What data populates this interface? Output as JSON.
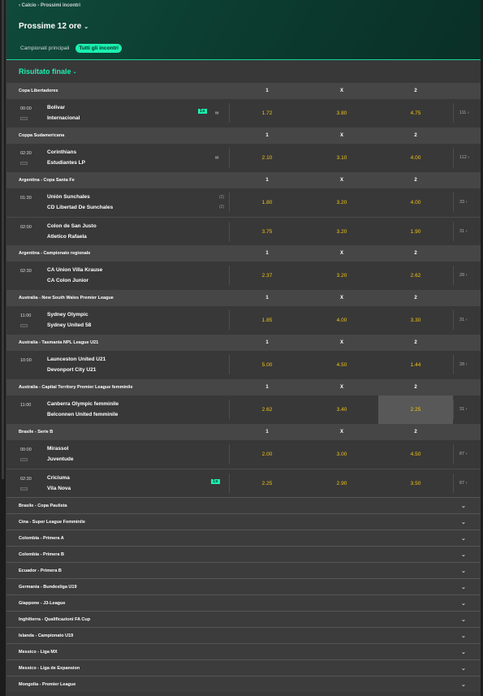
{
  "header": {
    "breadcrumb": "‹ Calcio - Prossimi incontri",
    "title": "Prossime 12 ore",
    "tabs": [
      {
        "label": "Campionati principali",
        "active": false
      },
      {
        "label": "Tutti gli incontri",
        "active": true
      }
    ]
  },
  "market": {
    "label": "Risultato finale"
  },
  "columns": {
    "one": "1",
    "x": "X",
    "two": "2"
  },
  "leagues": [
    {
      "name": "Copa Libertadores",
      "matches": [
        {
          "time": "00:00",
          "tv": true,
          "home": "Bolivar",
          "away": "Internacional",
          "badge": "1⨯",
          "stats": true,
          "odds": [
            "1.72",
            "3.80",
            "4.75"
          ],
          "markets": "111 ›"
        }
      ]
    },
    {
      "name": "Coppa Sudamericana",
      "matches": [
        {
          "time": "02:30",
          "tv": true,
          "home": "Corinthians",
          "away": "Estudiantes LP",
          "stats": true,
          "odds": [
            "2.10",
            "3.10",
            "4.00"
          ],
          "markets": "112 ›"
        }
      ]
    },
    {
      "name": "Argentina - Copa Santa Fe",
      "matches": [
        {
          "time": "01:30",
          "home": "Unión Sunchales",
          "away": "CD Libertad De Sunchales",
          "ranks": [
            "(2)",
            "(2)"
          ],
          "odds": [
            "1.80",
            "3.20",
            "4.00"
          ],
          "markets": "33 ›"
        },
        {
          "time": "02:00",
          "home": "Colon de San Justo",
          "away": "Atletico Rafaela",
          "odds": [
            "3.75",
            "3.20",
            "1.90"
          ],
          "markets": "31 ›"
        }
      ]
    },
    {
      "name": "Argentina - Campionato regionale",
      "matches": [
        {
          "time": "02:30",
          "home": "CA Union Villa Krause",
          "away": "CA Colon Junior",
          "odds": [
            "2.37",
            "3.20",
            "2.62"
          ],
          "markets": "28 ›"
        }
      ]
    },
    {
      "name": "Australia - New South Wales Premier League",
      "matches": [
        {
          "time": "11:00",
          "tv": true,
          "home": "Sydney Olympic",
          "away": "Sydney United 58",
          "odds": [
            "1.85",
            "4.00",
            "3.30"
          ],
          "markets": "31 ›"
        }
      ]
    },
    {
      "name": "Australia - Tasmania NPL League U21",
      "matches": [
        {
          "time": "10:00",
          "home": "Launceston United U21",
          "away": "Devonport City U21",
          "odds": [
            "5.00",
            "4.50",
            "1.44"
          ],
          "markets": "28 ›"
        }
      ]
    },
    {
      "name": "Australia - Capital Territory Premier League femminile",
      "matches": [
        {
          "time": "11:00",
          "home": "Canberra Olympic femminile",
          "away": "Belconnen United femminile",
          "odds": [
            "2.62",
            "3.40",
            "2.25"
          ],
          "highlight": 2,
          "markets": "31 ›"
        }
      ]
    },
    {
      "name": "Brasile - Serie B",
      "matches": [
        {
          "time": "00:00",
          "tv": true,
          "home": "Mirassol",
          "away": "Juventude",
          "odds": [
            "2.00",
            "3.00",
            "4.50"
          ],
          "markets": "87 ›"
        },
        {
          "time": "02:30",
          "tv": true,
          "home": "Criciuma",
          "away": "Vila Nova",
          "badge": "1⨯",
          "odds": [
            "2.25",
            "2.90",
            "3.50"
          ],
          "markets": "87 ›"
        }
      ]
    }
  ],
  "collapsed": [
    "Brasile - Copa Paulista",
    "Cina - Super League Femminile",
    "Colombia - Primera A",
    "Colombia - Primera B",
    "Ecuador - Primera B",
    "Germania - Bundesliga U19",
    "Giappone - J3-League",
    "Inghilterra - Qualificazioni FA Cup",
    "Islanda - Campionato U19",
    "Messico - Liga MX",
    "Messico - Liga de Expansion",
    "Mongolia - Premier League"
  ],
  "colors": {
    "accent": "#1af0b0",
    "odds": "#f0c419",
    "header_bg": "#0f4a3a"
  }
}
